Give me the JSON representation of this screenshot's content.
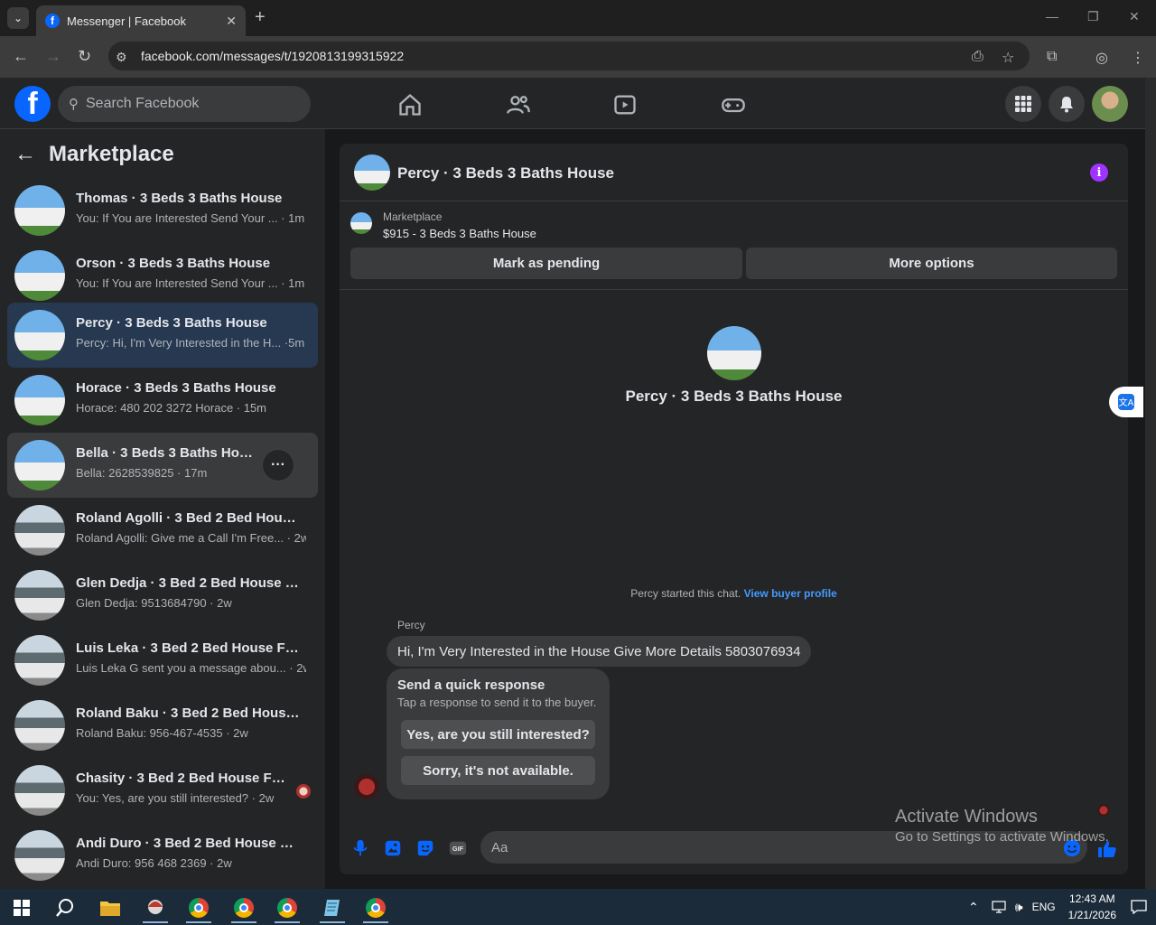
{
  "browser": {
    "tab_title": "Messenger | Facebook",
    "url": "facebook.com/messages/t/1920813199315922"
  },
  "fb": {
    "search_placeholder": "Search Facebook"
  },
  "sidebar": {
    "title": "Marketplace",
    "conversations": [
      {
        "name": "Thomas · 3 Beds 3 Baths House",
        "snippet": "You: If You are Interested Send Your ... · 1m"
      },
      {
        "name": "Orson · 3 Beds 3 Baths House",
        "snippet": "You: If You are Interested Send Your ... · 1m"
      },
      {
        "name": "Percy · 3 Beds 3 Baths House",
        "snippet": "Percy: Hi, I'm Very Interested in the H... ·5m"
      },
      {
        "name": "Horace · 3 Beds 3 Baths House",
        "snippet": "Horace: 480 202 3272 Horace · 15m"
      },
      {
        "name": "Bella · 3 Beds 3 Baths House",
        "snippet": "Bella: 2628539825 · 17m"
      },
      {
        "name": "Roland Agolli · 3 Bed 2 Bed House...",
        "snippet": "Roland Agolli: Give me a Call I'm Free... · 2w"
      },
      {
        "name": "Glen Dedja · 3 Bed 2 Bed House Fo...",
        "snippet": "Glen Dedja: 9513684790 · 2w"
      },
      {
        "name": "Luis Leka · 3 Bed 2 Bed House For ...",
        "snippet": "Luis Leka G sent you a message abou... · 2w"
      },
      {
        "name": "Roland Baku · 3 Bed 2 Bed House ...",
        "snippet": "Roland Baku: 956-467-4535 · 2w"
      },
      {
        "name": "Chasity · 3 Bed 2 Bed House For...",
        "snippet": "You: Yes, are you still interested? · 2w"
      },
      {
        "name": "Andi Duro · 3 Bed 2 Bed House Fo...",
        "snippet": "Andi Duro: 956 468 2369 · 2w"
      }
    ]
  },
  "chat": {
    "title": "Percy · 3 Beds 3 Baths House",
    "listing_source": "Marketplace",
    "listing_title": "$915 - 3 Beds 3 Baths House",
    "mark_pending_label": "Mark as pending",
    "more_options_label": "More options",
    "center_name": "Percy · 3 Beds 3 Baths House",
    "started_text": "Percy started this chat.",
    "view_profile_label": "View buyer profile",
    "sender": "Percy",
    "message": "Hi, I'm Very Interested in the House Give More Details 5803076934",
    "quick_title": "Send a quick response",
    "quick_sub": "Tap a response to send it to the buyer.",
    "quick_options": [
      "Yes, are you still interested?",
      "Sorry, it's not available."
    ],
    "input_placeholder": "Aa"
  },
  "watermark": {
    "line1": "Activate Windows",
    "line2": "Go to Settings to activate Windows."
  },
  "taskbar": {
    "lang": "ENG",
    "time": "12:43 AM",
    "date": "1/21/2026"
  },
  "colors": {
    "accent": "#0866ff",
    "active_row": "#263951",
    "info_purple": "#a033ff"
  }
}
